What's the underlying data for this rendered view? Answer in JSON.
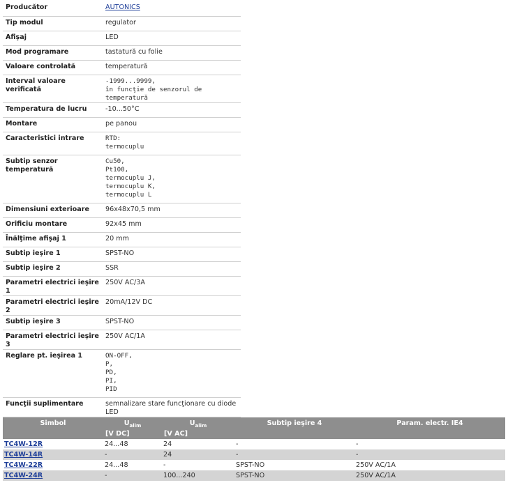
{
  "specs": [
    {
      "label": "Producător",
      "value": [
        "AUTONICS"
      ],
      "link": true
    },
    {
      "label": "Tip modul",
      "value": [
        "regulator"
      ]
    },
    {
      "label": "Afişaj",
      "value": [
        "LED"
      ]
    },
    {
      "label": "Mod programare",
      "value": [
        "tastatură cu folie"
      ]
    },
    {
      "label": "Valoare controlată",
      "value": [
        "temperatură"
      ]
    },
    {
      "label": "Interval valoare verificată",
      "value": [
        "-1999...9999,",
        "în funcţie de senzorul de temperatură"
      ]
    },
    {
      "label": "Temperatura de lucru",
      "value": [
        "-10...50°C"
      ]
    },
    {
      "label": "Montare",
      "value": [
        "pe panou"
      ]
    },
    {
      "label": "Caracteristici intrare",
      "value": [
        "RTD:",
        "termocuplu"
      ]
    },
    {
      "label": "Subtip senzor temperatură",
      "value": [
        "Cu50,",
        "Pt100,",
        "termocuplu J,",
        "termocuplu K,",
        "termocuplu L"
      ]
    },
    {
      "label": "Dimensiuni exterioare",
      "value": [
        "96x48x70,5 mm"
      ]
    },
    {
      "label": "Orificiu montare",
      "value": [
        "92x45 mm"
      ]
    },
    {
      "label": "Înălţime afişaj 1",
      "value": [
        "20 mm"
      ]
    },
    {
      "label": "Subtip ieşire 1",
      "value": [
        "SPST-NO"
      ]
    },
    {
      "label": "Subtip ieşire 2",
      "value": [
        "SSR"
      ]
    },
    {
      "label": "Parametri electrici ieşire 1",
      "value": [
        "250V AC/3A"
      ]
    },
    {
      "label": "Parametri electrici ieşire 2",
      "value": [
        "20mA/12V DC"
      ]
    },
    {
      "label": "Subtip ieşire 3",
      "value": [
        "SPST-NO"
      ]
    },
    {
      "label": "Parametri electrici ieşire 3",
      "value": [
        "250V AC/1A"
      ]
    },
    {
      "label": "Reglare pt. ieşirea 1",
      "value": [
        "ON-OFF,",
        "P,",
        "PD,",
        "PI,",
        "PID"
      ]
    },
    {
      "label": "Funcţii suplimentare",
      "value": [
        "semnalizare stare funcţionare cu diode LED"
      ]
    }
  ],
  "variants": {
    "headers": {
      "symbol": "Simbol",
      "u_dc_main": "U",
      "u_dc_sub": "alim",
      "u_dc_unit": "[V DC]",
      "u_ac_main": "U",
      "u_ac_sub": "alim",
      "u_ac_unit": "[V AC]",
      "subtype4": "Subtip ieşire 4",
      "param4": "Param. electr. IE4"
    },
    "rows": [
      {
        "symbol": "TC4W-12R",
        "u_dc": "24...48",
        "u_ac": "24",
        "subtype4": "-",
        "param4": "-"
      },
      {
        "symbol": "TC4W-14R",
        "u_dc": "-",
        "u_ac": "24",
        "subtype4": "-",
        "param4": "-"
      },
      {
        "symbol": "TC4W-22R",
        "u_dc": "24...48",
        "u_ac": "-",
        "subtype4": "SPST-NO",
        "param4": "250V AC/1A"
      },
      {
        "symbol": "TC4W-24R",
        "u_dc": "-",
        "u_ac": "100...240",
        "subtype4": "SPST-NO",
        "param4": "250V AC/1A"
      }
    ]
  }
}
